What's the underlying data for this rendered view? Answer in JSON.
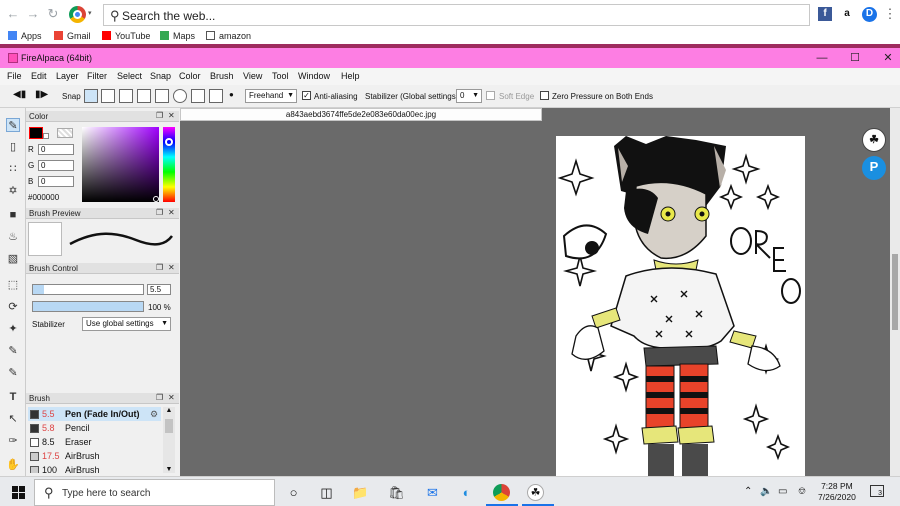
{
  "browser": {
    "omnibox_placeholder": "Search the web...",
    "bookmarks": [
      {
        "label": "Apps",
        "color": "#4285f4"
      },
      {
        "label": "Gmail",
        "color": "#ea4335"
      },
      {
        "label": "YouTube",
        "color": "#ff0000"
      },
      {
        "label": "Maps",
        "color": "#34a853"
      },
      {
        "label": "amazon",
        "color": "#555555"
      }
    ],
    "extensions": [
      "f",
      "a",
      "D"
    ]
  },
  "app": {
    "title": "FireAlpaca (64bit)",
    "menus": [
      "File",
      "Edit",
      "Layer",
      "Filter",
      "Select",
      "Snap",
      "Color",
      "Brush",
      "View",
      "Tool",
      "Window",
      "Help"
    ],
    "toolbar": {
      "snap_label": "Snap",
      "mode": "Freehand",
      "anti_aliasing": "Anti-aliasing",
      "stabilizer_label": "Stabilizer (Global settings)",
      "stabilizer_value": "0",
      "soft_edge": "Soft Edge",
      "zero_pressure": "Zero Pressure on Both Ends"
    }
  },
  "panels": {
    "color": {
      "title": "Color",
      "r_label": "R",
      "r": "0",
      "g_label": "G",
      "g": "0",
      "b_label": "B",
      "b": "0",
      "hex": "#000000"
    },
    "brush_preview": {
      "title": "Brush Preview"
    },
    "brush_control": {
      "title": "Brush Control",
      "size": "5.5",
      "opacity": "100 %",
      "stabilizer_label": "Stabilizer",
      "stabilizer_value": "Use global settings"
    },
    "brush": {
      "title": "Brush",
      "items": [
        {
          "size": "5.5",
          "name": "Pen (Fade In/Out)"
        },
        {
          "size": "5.8",
          "name": "Pencil"
        },
        {
          "size": "8.5",
          "name": "Eraser"
        },
        {
          "size": "17.5",
          "name": "AirBrush"
        },
        {
          "size": "100",
          "name": "AirBrush"
        }
      ]
    }
  },
  "canvas": {
    "file_tab": "a843aebd3674ffe5de2e083e60da00ec.jpg",
    "artwork_text": "OREO"
  },
  "taskbar": {
    "search_placeholder": "Type here to search",
    "time": "7:28 PM",
    "date": "7/26/2020",
    "notification_count": "3"
  }
}
